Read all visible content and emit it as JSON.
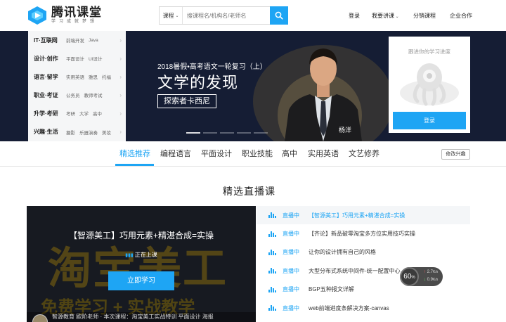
{
  "header": {
    "logo_title": "腾讯课堂",
    "logo_slogan": "学习成就梦想",
    "search_type": "课程",
    "search_placeholder": "搜课程名/机构名/老师名",
    "nav": [
      "登录",
      "我要讲课",
      "分销课程",
      "企业合作"
    ]
  },
  "categories": [
    {
      "main": "IT·互联网",
      "subs": [
        "前端开发",
        "Java"
      ]
    },
    {
      "main": "设计·创作",
      "subs": [
        "平面设计",
        "UI设计"
      ]
    },
    {
      "main": "语言·留学",
      "subs": [
        "实用英语",
        "雅思",
        "托福"
      ]
    },
    {
      "main": "职业·考证",
      "subs": [
        "公务员",
        "教师考试"
      ]
    },
    {
      "main": "升学·考研",
      "subs": [
        "考研",
        "大学",
        "高中"
      ]
    },
    {
      "main": "兴趣·生活",
      "subs": [
        "摄影",
        "乐器演奏",
        "美妆"
      ]
    }
  ],
  "banner": {
    "subtitle": "2018暑假•高考语文一轮复习（上）",
    "title": "文学的发现",
    "tag": "探索者卡西尼",
    "teacher": "杨洋",
    "slide_count": 5,
    "active_slide": 0
  },
  "login_card": {
    "tip": "跟进你的学习进度",
    "button": "登录"
  },
  "tabs": {
    "items": [
      "精选推荐",
      "编程语言",
      "平面设计",
      "职业技能",
      "高中",
      "实用英语",
      "文艺修养"
    ],
    "active": 0,
    "modify": "修改兴趣"
  },
  "section_title": "精选直播课",
  "player": {
    "title": "【智源美工】巧用元素+精湛合成=实操",
    "bg_text": "淘宝美工",
    "bg_text2": "免费学习 + 实战教学",
    "live_label": "正在上课",
    "button": "立即学习",
    "footer": "智源教育   欧阶老师   · 本次课程：淘宝美工实战特训 平面设计 海报"
  },
  "live_list": [
    {
      "status": "直播中",
      "title": "【智源美工】巧用元素+精湛合成=实操"
    },
    {
      "status": "直播中",
      "title": "【齐论】新品破零淘宝多方位实用技巧实操"
    },
    {
      "status": "直播中",
      "title": "让你的设计拥有自己的风格"
    },
    {
      "status": "直播中",
      "title": "大型分布式系统中间件-统一配置中心"
    },
    {
      "status": "直播中",
      "title": "BGP五种报文详解"
    },
    {
      "status": "直播中",
      "title": "web前端进度条解决方案-canvas"
    }
  ],
  "speed_widget": {
    "value": "60",
    "unit": "%",
    "up": "2.7",
    "up_unit": "K/s",
    "down": "0.9",
    "down_unit": "K/s"
  },
  "colors": {
    "accent": "#1ea5f4",
    "banner_bg": "#151d34"
  }
}
